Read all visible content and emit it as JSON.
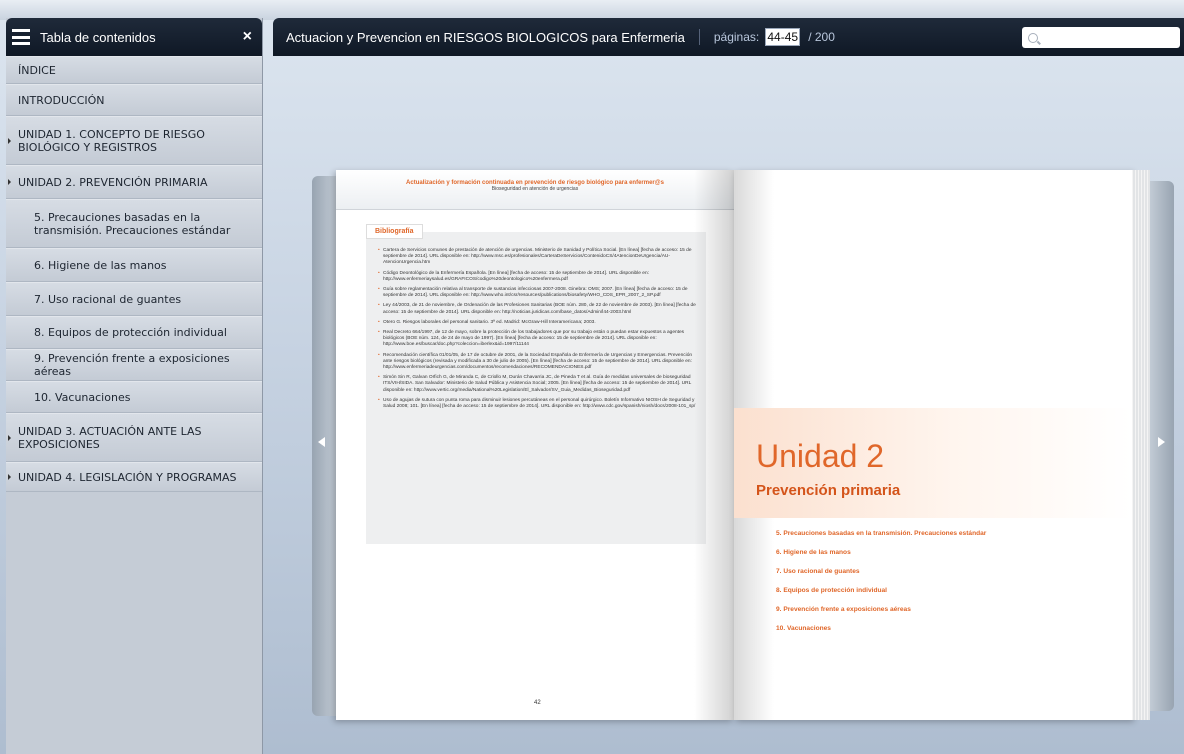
{
  "sidebar": {
    "title": "Tabla de contenidos",
    "close": "×",
    "items": [
      {
        "label": "ÍNDICE",
        "level": 0
      },
      {
        "label": "INTRODUCCIÓN",
        "level": 0
      },
      {
        "label": "UNIDAD 1. CONCEPTO DE RIESGO BIOLÓGICO Y REGISTROS",
        "level": 0
      },
      {
        "label": "UNIDAD 2. PREVENCIÓN PRIMARIA",
        "level": 0
      },
      {
        "label": "5. Precauciones basadas en la transmisión. Precauciones estándar",
        "level": 1
      },
      {
        "label": "6. Higiene de las manos",
        "level": 1
      },
      {
        "label": "7. Uso racional de guantes",
        "level": 1
      },
      {
        "label": "8. Equipos de protección individual",
        "level": 1
      },
      {
        "label": "9. Prevención frente a exposiciones aéreas",
        "level": 1
      },
      {
        "label": "10. Vacunaciones",
        "level": 1
      },
      {
        "label": "UNIDAD 3. ACTUACIÓN ANTE LAS EXPOSICIONES",
        "level": 0
      },
      {
        "label": "UNIDAD 4. LEGISLACIÓN Y PROGRAMAS",
        "level": 0
      }
    ]
  },
  "topbar": {
    "doc_title": "Actuacion y Prevencion en RIESGOS BIOLOGICOS para Enfermeria",
    "pages_label": "páginas:",
    "pages_value": "44-45",
    "pages_total": "/ 200"
  },
  "left_page": {
    "header_line1": "Actualización y formación continuada en prevención de riesgo biológico para enfermer@s",
    "header_line2": "Bioseguridad en atención de urgencias",
    "biblio_title": "Bibliografía",
    "refs": [
      "Cartera de Servicios comunes de prestación de atención de urgencias. Ministerio de Sanidad y Política Social. [En línea] [fecha de acceso: 15 de septiembre de 2014]. URL disponible en: http://www.msc.es/profesionales/CarteraDeServicios/ContenidoCS/4AtencionDeUrgencia/AU-AtencionUrgencia.htm",
      "Código Deontológico de la Enfermería Española. [En línea] [fecha de acceso: 15 de septiembre de 2014]. URL disponible en: http://www.enfermeriaysalud.es/GRAFICOS/codigo%20deontologico%20enfermera.pdf",
      "Guía sobre reglamentación relativa al transporte de sustancias infecciosas 2007-2008. Ginebra: OMS; 2007. [En línea] [fecha de acceso: 15 de septiembre de 2014]. URL disponible en: http://www.who.int/csr/resources/publications/biosafety/WHO_CDS_EPR_2007_2_SP.pdf",
      "Ley 44/2003, de 21 de noviembre, de Ordenación de las Profesiones Sanitarias (BOE núm. 280, de 22 de noviembre de 2003). [En línea] [fecha de acceso: 15 de septiembre de 2014]. URL disponible en: http://noticias.juridicas.com/base_datos/Admin/l44-2003.html",
      "Otero G. Riesgos laborales del personal sanitario. 3ª ed. Madrid: McGraw-Hill Interamericana; 2003.",
      "Real Decreto 664/1997, de 12 de mayo, sobre la protección de los trabajadores que por su trabajo están o puedan estar expuestos a agentes biológicos (BOE núm. 124, de 24 de mayo de 1997). [En línea] [fecha de acceso: 15 de septiembre de 2014]. URL disponible en: http://www.boe.es/buscar/doc.php?coleccion=iberlex&id=1997/11144",
      "Recomendación científica 01/01/05, de 17 de octubre de 2001, de la Sociedad Española de Enfermería de Urgencias y Emergencias. Prevención ante riesgos biológicos (revisada y modificada a 30 de julio de 2005). [En línea] [fecha de acceso: 15 de septiembre de 2014]. URL disponible en: http://www.enfermeriadeurgencias.com/documentos/recomendaciones/RECOMENDACIONES.pdf",
      "Simón Sin R, Galvan Orfich G, de Miranda C, de Criollo M, Durán Chavarria JC, de Pineda T et al. Guía de medidas universales de bioseguridad ITS/VIH/SIDA. San Salvador: Ministerio de Salud Pública y Asistencia Social; 2005. [En línea] [fecha de acceso: 15 de septiembre de 2014]. URL disponible en: http://www.vertic.org/media/National%20Legislation/El_Salvador/SV_Guia_Medidas_Bioseguridad.pdf",
      "Uso de agujas de sutura con punta roma para disminuir lesiones percutáneas en el personal quirúrgico. Boletín Informativo NIOSH de Seguridad y Salud 2008; 101. [En línea] [fecha de acceso: 15 de septiembre de 2014]. URL disponible en: http://www.cdc.gov/spanish/niosh/docs/2008-101_sp/"
    ],
    "page_number": "42"
  },
  "right_page": {
    "unit_title": "Unidad 2",
    "unit_subtitle": "Prevención primaria",
    "topics": [
      "5. Precauciones basadas en la transmisión. Precauciones estándar",
      "6. Higiene de las manos",
      "7. Uso racional de guantes",
      "8. Equipos de protección individual",
      "9. Prevención frente a exposiciones aéreas",
      "10. Vacunaciones"
    ]
  },
  "colors": {
    "accent_orange": "#e0672a",
    "bar_dark": "#0f1825"
  },
  "icons": {
    "menu": "hamburger-icon",
    "search": "search-icon",
    "prev": "chevron-left-icon",
    "next": "chevron-right-icon"
  }
}
